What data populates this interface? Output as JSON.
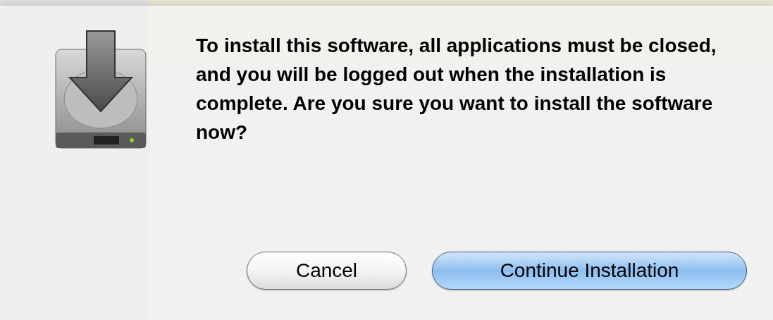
{
  "dialog": {
    "message": "To install this software, all applications must be closed, and you will be logged out when the installation is complete. Are you sure you want to install the software now?",
    "buttons": [
      {
        "label": "Cancel",
        "kind": "secondary"
      },
      {
        "label": "Continue Installation",
        "kind": "default"
      }
    ]
  }
}
